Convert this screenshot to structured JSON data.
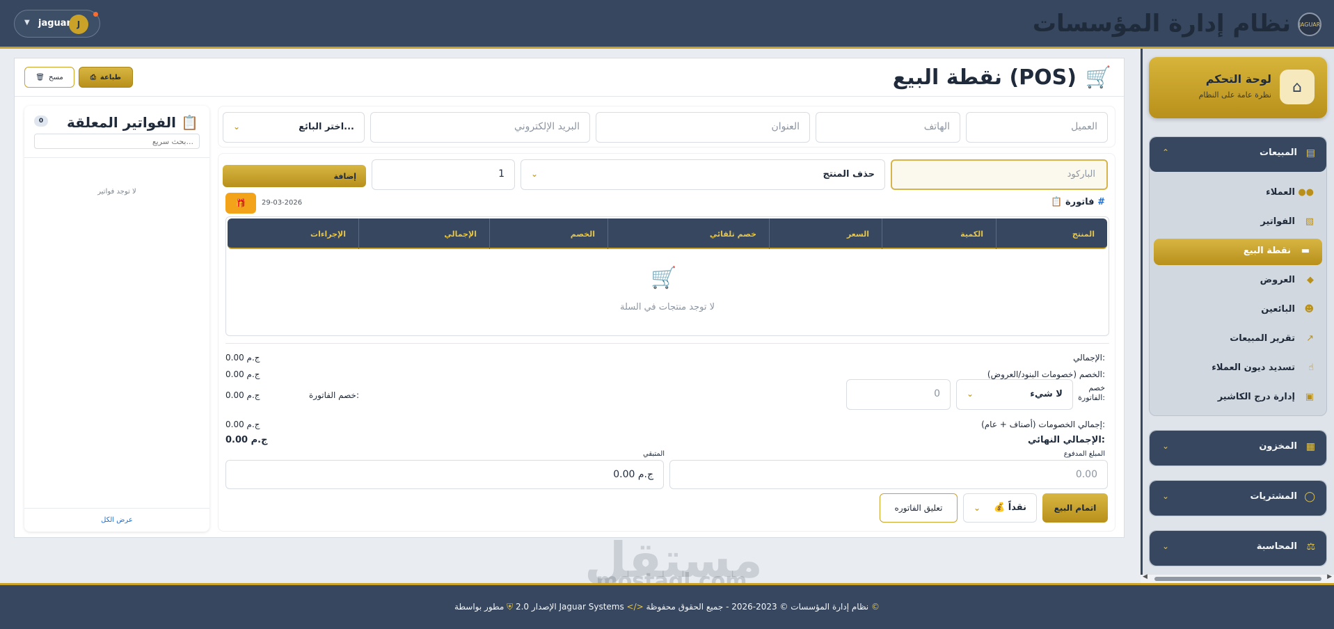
{
  "header": {
    "title": "نظام إدارة المؤسسات",
    "logo_text": "JAGUAR",
    "user_name": "jaguar",
    "user_initial": "J"
  },
  "sidebar": {
    "dashboard": {
      "title": "لوحة التحكم",
      "subtitle": "نظرة عامة على النظام"
    },
    "sales": {
      "title": "المبيعات",
      "items": [
        {
          "label": "العملاء",
          "icon": "users-icon"
        },
        {
          "label": "الفواتير",
          "icon": "invoice-icon"
        },
        {
          "label": "نقطة البيع",
          "icon": "card-icon",
          "active": true
        },
        {
          "label": "العروض",
          "icon": "tag-icon"
        },
        {
          "label": "البائعين",
          "icon": "user-tie-icon"
        },
        {
          "label": "تقرير المبيعات",
          "icon": "chart-line-icon"
        },
        {
          "label": "تسديد ديون العملاء",
          "icon": "hand-money-icon"
        },
        {
          "label": "إدارة درج الكاشير",
          "icon": "cash-drawer-icon"
        }
      ]
    },
    "inventory": {
      "title": "المخزون"
    },
    "purchases": {
      "title": "المشتريات"
    },
    "accounting": {
      "title": "المحاسبة"
    }
  },
  "pos": {
    "title": "نقطة البيع (POS)",
    "print_label": "طباعة",
    "clear_label": "مسح",
    "customer_placeholder": "العميل",
    "phone_placeholder": "الهاتف",
    "address_placeholder": "العنوان",
    "email_placeholder": "البريد الإلكتروني",
    "seller_select": "اختر البائع...",
    "barcode_placeholder": "الباركود",
    "product_select": "حذف المنتج",
    "quantity": "1",
    "add_label": "إضافة",
    "invoice_label": "فاتورة",
    "invoice_hash": "#",
    "invoice_date": "29-03-2026",
    "table": {
      "columns": [
        "المنتج",
        "الكمية",
        "السعر",
        "خصم تلقائي",
        "الخصم",
        "الإجمالي",
        "الإجراءات"
      ],
      "empty": "لا توجد منتجات في السلة"
    },
    "summary": {
      "total_label": "الإجمالي:",
      "total_value": "0.00 ج.م",
      "item_discount_label": "الخصم (خصومات البنود/العروض):",
      "item_discount_value": "0.00 ج.م",
      "invoice_discount_label": "خصم الفاتورة:",
      "invoice_discount_type": "لا شيء",
      "invoice_discount_input": "0",
      "invoice_discount_value_label": "خصم الفاتورة:",
      "invoice_discount_value": "0.00 ج.م",
      "all_discounts_label": "إجمالي الخصومات (أصناف + عام):",
      "all_discounts_value": "0.00 ج.م",
      "final_label": "الإجمالي النهائي:",
      "final_value": "0.00 ج.م",
      "paid_label": "المبلغ المدفوع",
      "paid_placeholder": "0.00",
      "remaining_label": "المتبقي",
      "remaining_value": "0.00 ج.م"
    },
    "finish_label": "اتمام البيع",
    "payment_method": "نقداً",
    "suspend_label": "تعليق الفاتوره"
  },
  "pending": {
    "title": "الفواتير المعلقة",
    "count": "0",
    "search_placeholder": "بحث سريع...",
    "empty": "لا توجد فواتير",
    "view_all": "عرض الكل"
  },
  "footer": {
    "text": "نظام إدارة المؤسسات © 2023-2026 - جميع الحقوق محفوظة",
    "dev_text": "مطور بواسطة Jaguar Systems",
    "version": "الإصدار 2.0"
  },
  "watermark": {
    "main": "مستقل",
    "sub": "mostaql.com"
  },
  "colors": {
    "primary": "#36475f",
    "accent": "#c9a227",
    "link": "#1f6fd1",
    "orange": "#f2a31a"
  }
}
